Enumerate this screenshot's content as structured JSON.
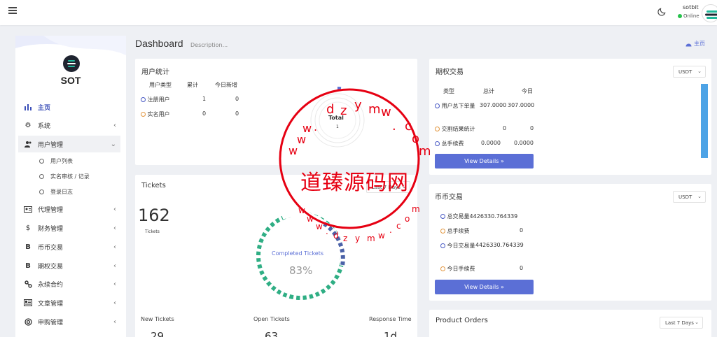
{
  "topbar": {
    "menu_icon": "hamburger-icon",
    "theme_icon": "moon-icon",
    "user_name": "sotbit",
    "user_status": "Online",
    "status_color": "#27c24c"
  },
  "sidebar": {
    "brand": "SOT",
    "items": [
      {
        "label": "主页",
        "icon": "bar-chart-icon"
      },
      {
        "label": "系统",
        "icon": "gear-icon"
      },
      {
        "label": "用户管理",
        "icon": "users-icon"
      },
      {
        "label": "代理管理",
        "icon": "id-card-icon"
      },
      {
        "label": "财务管理",
        "icon": "dollar-icon"
      },
      {
        "label": "币币交易",
        "icon": "bitcoin-icon"
      },
      {
        "label": "期权交易",
        "icon": "bitcoin-icon"
      },
      {
        "label": "永续合约",
        "icon": "link-icon"
      },
      {
        "label": "文章管理",
        "icon": "newspaper-icon"
      },
      {
        "label": "申购管理",
        "icon": "lifebuoy-icon"
      }
    ],
    "sub_items": [
      "用户列表",
      "实名审核 / 记录",
      "登录日志"
    ]
  },
  "header": {
    "title": "Dashboard",
    "description": "Description...",
    "home_link": "主页"
  },
  "user_stats": {
    "title": "用户统计",
    "columns": [
      "用户类型",
      "累计",
      "今日新增"
    ],
    "rows": [
      {
        "label": "注册用户",
        "total": "1",
        "today": "0"
      },
      {
        "label": "实名用户",
        "total": "0",
        "today": "0"
      }
    ],
    "donut_label": "Total",
    "donut_value": "1"
  },
  "options": {
    "title": "期权交易",
    "currency": "USDT",
    "columns": [
      "类型",
      "总计",
      "今日"
    ],
    "rows": [
      {
        "label": "用户总下单量",
        "total": "307.0000",
        "today": "307.0000"
      },
      {
        "label": "交割结果统计",
        "total": "0",
        "today": "0"
      },
      {
        "label": "总手续费",
        "total": "0.0000",
        "today": "0.0000"
      }
    ],
    "button": "View Details »"
  },
  "tickets": {
    "title": "Tickets",
    "range": "Last 7 Days",
    "count": "162",
    "count_label": "Tickets",
    "gauge_label": "Completed Tickets",
    "gauge_value": "83%",
    "stats": [
      {
        "label": "New Tickets",
        "value": "29"
      },
      {
        "label": "Open Tickets",
        "value": "63"
      },
      {
        "label": "Response Time",
        "value": "1d"
      }
    ]
  },
  "spot": {
    "title": "币币交易",
    "currency": "USDT",
    "rows": [
      {
        "label": "总交易量",
        "value": "4426330.764339"
      },
      {
        "label": "总手续费",
        "value": "0"
      },
      {
        "label": "今日交易量",
        "value": "4426330.764339"
      },
      {
        "label": "今日手续费",
        "value": "0"
      }
    ],
    "button": "View Details »"
  },
  "product_orders": {
    "title": "Product Orders",
    "range": "Last 7 Days"
  },
  "watermark": {
    "title": "道臻源码网",
    "letters_top": [
      "d",
      "z",
      "y",
      "m",
      "w",
      ".",
      "c",
      "o",
      "m"
    ],
    "letters_left": [
      "w",
      "w",
      "w",
      "."
    ],
    "letters_bottom": [
      "w",
      "w",
      "w",
      ".",
      "d",
      "z",
      "y",
      "m",
      "w",
      ".",
      "c",
      "o",
      "m"
    ],
    "color": "#e60012"
  }
}
